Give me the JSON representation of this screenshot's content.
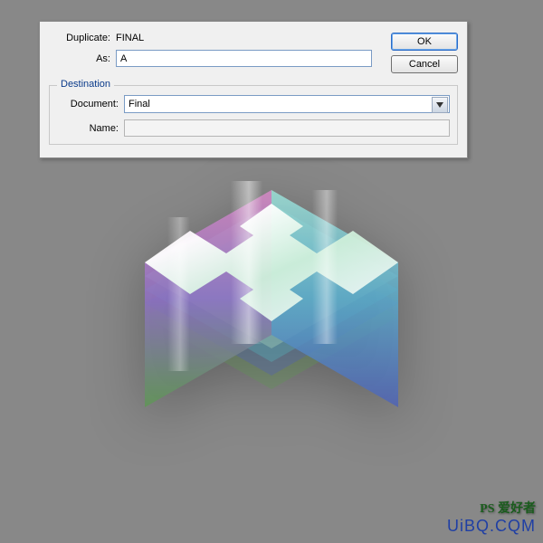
{
  "dialog": {
    "duplicate_label": "Duplicate:",
    "duplicate_value": "FINAL",
    "as_label": "As:",
    "as_value": "A",
    "destination_title": "Destination",
    "document_label": "Document:",
    "document_value": "Final",
    "name_label": "Name:",
    "name_value": "",
    "ok_label": "OK",
    "cancel_label": "Cancel"
  },
  "watermark": {
    "top": "PS 爱好者",
    "bottom": "UiBQ.CQM"
  }
}
